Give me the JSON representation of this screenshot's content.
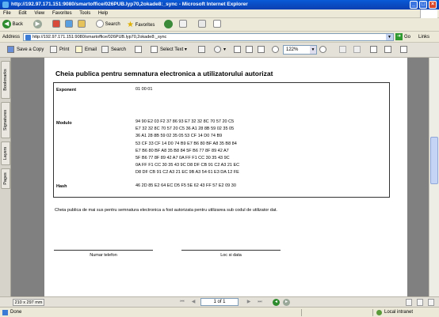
{
  "window": {
    "title": "http://192.97.171.151:9080/smartoffice/026PUB.lyp70,2okade8:_sync - Microsoft Internet Explorer",
    "min": "_",
    "max": "□",
    "close": "×"
  },
  "menu": [
    "File",
    "Edit",
    "View",
    "Favorites",
    "Tools",
    "Help"
  ],
  "navbar": {
    "back_label": "Back",
    "search_label": "Search",
    "favorites_label": "Favorites"
  },
  "address": {
    "label": "Address",
    "url": "http://192.97.171.151:9080/smartoffice/026PUB.lyp70,2okade8:_sync",
    "go_label": "Go",
    "links_label": "Links"
  },
  "pdf_toolbar": {
    "save_copy": "Save a Copy",
    "print": "Print",
    "email": "Email",
    "search": "Search",
    "select_text": "Select Text",
    "zoom": "122%"
  },
  "side_tabs": [
    "Bookmarks",
    "Signatures",
    "Layers",
    "Pages"
  ],
  "document": {
    "title": "Cheia publica pentru semnatura electronica a utilizatorului autorizat",
    "exponent_label": "Exponent",
    "exponent_value": "01 00 01",
    "modulo_label": "Modulo",
    "modulo_lines": [
      "94 90 E2 03 F2 37 86 93 E7 32 32 8C 70 57 20 C5",
      "E7 32 32 8C 70 57 20 C5 36 A1 28 8B 59 02 35 05",
      "36 A1 28 8B 59 02 35 05 53 CF 14 D0 74 B9",
      "53 CF 33 CF 14 D0 74 B9 E7 B6 80 BF A8 35 B8 84",
      "E7 B6 80 BF A8 35 B8 84 5F B6 77 8F 89 42 A7",
      "5F B6 77 8F 89 42 A7 0A FF F1 CC 30 35 43 9C",
      "0A FF F1 CC 30 35 43 9C D8 DF CB 91 C2 A3 21 EC",
      "D8 DF CB 91 C2 A3 21 EC 9B A3 54 61 E3 DA 12 FE"
    ],
    "hash_label": "Hash",
    "hash_value": "46 2D 85 E2 64 EC D5 F5 5E 62 43 FF 57 E2 09 30",
    "note": "Cheia publica de mai sus pentru semnatura electronica a fost autorizata pentru utilizarea sub codul de utilizator dat.",
    "sig_left": "Numar telefon",
    "sig_right": "Loc si data"
  },
  "bottom_nav": {
    "page_size": "210 x 297 mm",
    "page_indicator": "1 of 1"
  },
  "status": {
    "left": "Done",
    "zone": "Local intranet"
  }
}
